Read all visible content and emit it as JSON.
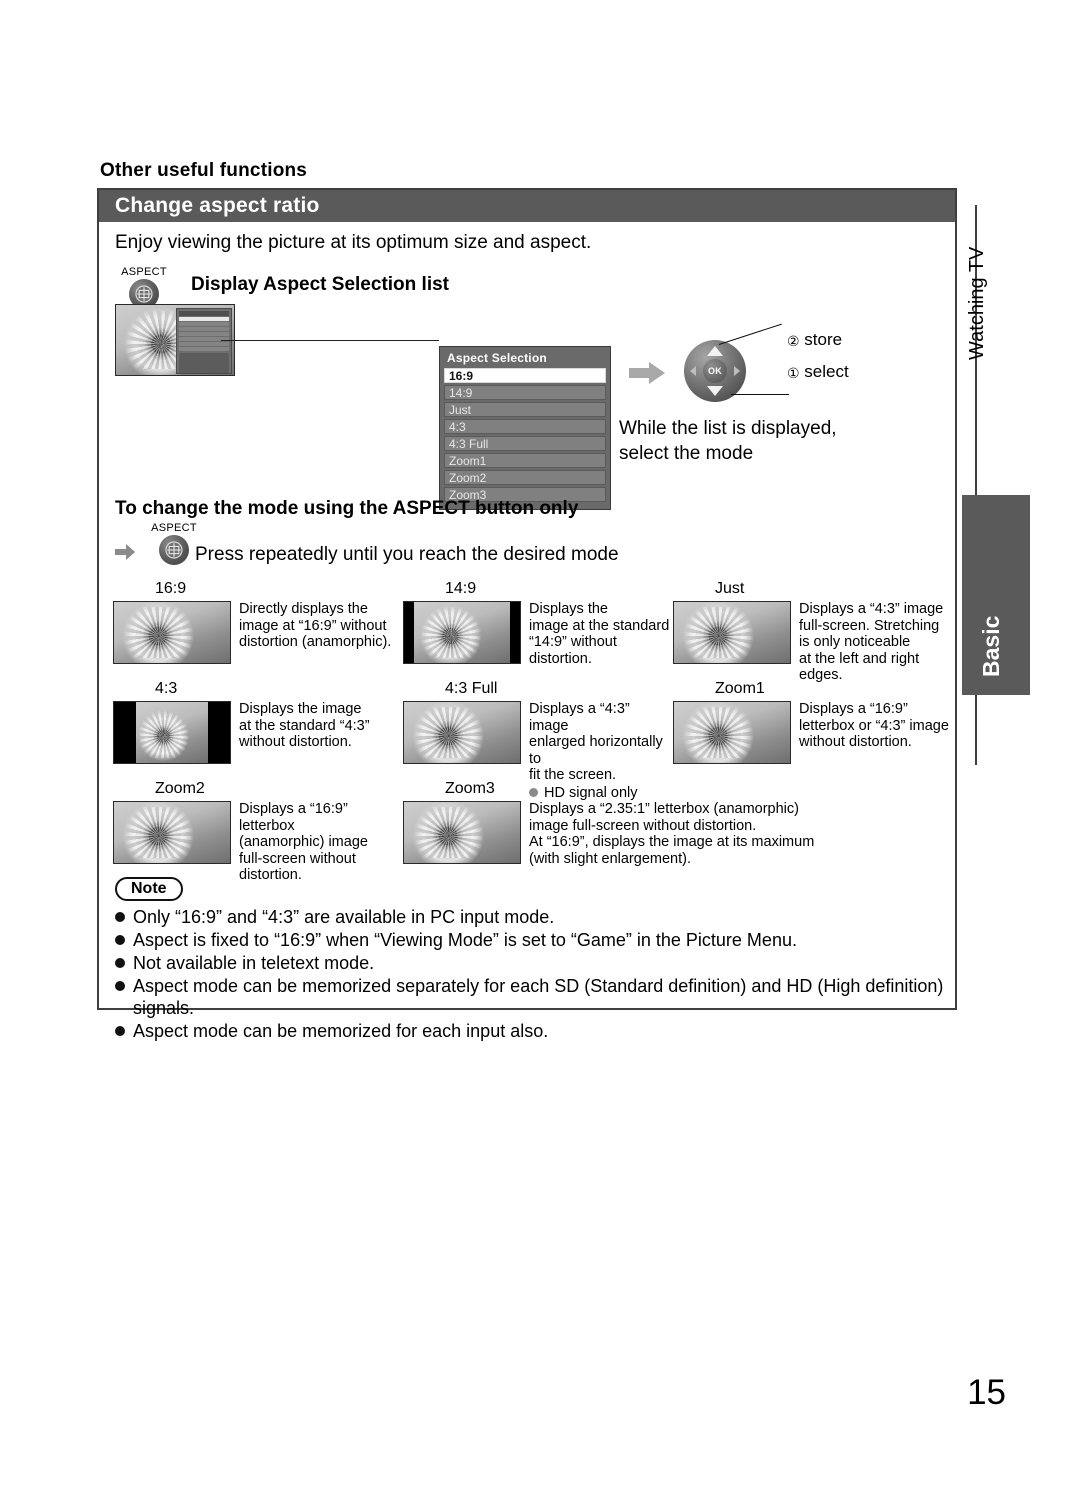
{
  "page": {
    "number": "15",
    "kicker": "Other useful functions"
  },
  "box": {
    "header": "Change aspect ratio",
    "intro": "Enjoy viewing the picture at its optimum size and aspect."
  },
  "step1": {
    "button_caption": "ASPECT",
    "button_icon": "aspect-icon",
    "label": "Display Aspect Selection list",
    "while_text": "While the list is displayed,\nselect the mode"
  },
  "osd": {
    "title": "Aspect Selection",
    "items": [
      {
        "label": "16:9",
        "selected": true
      },
      {
        "label": "14:9",
        "selected": false
      },
      {
        "label": "Just",
        "selected": false
      },
      {
        "label": "4:3",
        "selected": false
      },
      {
        "label": "4:3 Full",
        "selected": false
      },
      {
        "label": "Zoom1",
        "selected": false
      },
      {
        "label": "Zoom2",
        "selected": false
      },
      {
        "label": "Zoom3",
        "selected": false
      }
    ]
  },
  "pad": {
    "ok_label": "OK",
    "store_number": "②",
    "store_label": "store",
    "select_number": "①",
    "select_label": "select"
  },
  "step2": {
    "heading": "To change the mode using the ASPECT button only",
    "button_caption": "ASPECT",
    "instruction": "Press repeatedly until you reach the desired mode"
  },
  "modes": [
    {
      "name": "16:9",
      "thumb": "full-bleed",
      "desc": "Directly displays the\nimage at “16:9” without\ndistortion (anamorphic)."
    },
    {
      "name": "14:9",
      "thumb": "side-bars-narrow",
      "desc": "Displays the\nimage at the standard\n“14:9” without\ndistortion."
    },
    {
      "name": "Just",
      "thumb": "full-bleed",
      "desc": "Displays a “4:3” image\nfull-screen. Stretching\nis only noticeable\nat the left and right\nedges."
    },
    {
      "name": "4:3",
      "thumb": "side-bars-wide",
      "desc": "Displays the image\nat the standard “4:3”\nwithout distortion."
    },
    {
      "name": "4:3 Full",
      "thumb": "full-bleed",
      "desc": "Displays a “4:3” image\nenlarged horizontally to\nfit the screen.",
      "extra_note": "HD signal only"
    },
    {
      "name": "Zoom1",
      "thumb": "full-bleed",
      "desc": "Displays a “16:9”\nletterbox or “4:3” image\nwithout distortion."
    },
    {
      "name": "Zoom2",
      "thumb": "full-bleed",
      "desc": "Displays a “16:9”\nletterbox\n(anamorphic) image\nfull-screen without\ndistortion."
    },
    {
      "name": "Zoom3",
      "thumb": "full-bleed",
      "desc": "Displays a “2.35:1” letterbox (anamorphic)\nimage full-screen without distortion.\nAt “16:9”, displays the image at its maximum\n(with slight enlargement)."
    }
  ],
  "note": {
    "badge": "Note",
    "items": [
      "Only “16:9” and “4:3” are available in PC input mode.",
      "Aspect is fixed to “16:9” when “Viewing Mode” is set to “Game” in the Picture Menu.",
      "Not available in teletext mode.",
      "Aspect mode can be memorized separately for each SD (Standard definition) and HD (High definition) signals.",
      "Aspect mode can be memorized for each input also."
    ]
  },
  "sidebar": {
    "chapter": "Watching TV",
    "tab": "Basic"
  },
  "colors": {
    "header_gray": "#5a5a5a",
    "border_dark": "#3f3f3f",
    "osd_gray": "#6a6a6a",
    "osd_item_gray": "#808080",
    "selected_white": "#ffffff"
  }
}
